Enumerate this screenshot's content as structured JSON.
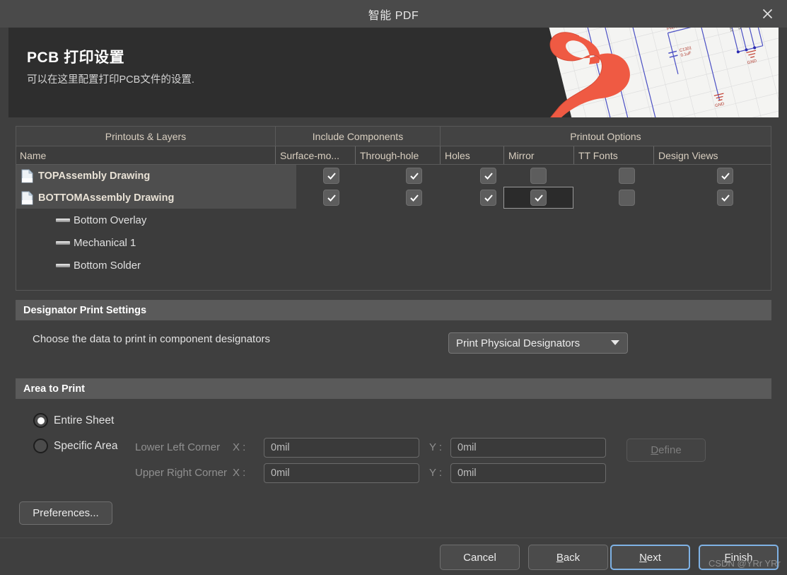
{
  "window": {
    "title": "智能 PDF",
    "close_icon": "close-icon"
  },
  "banner": {
    "title": "PCB 打印设置",
    "subtitle": "可以在这里配置打印PCB文件的设置."
  },
  "table": {
    "group_headers": [
      "Printouts & Layers",
      "Include Components",
      "Printout Options"
    ],
    "column_headers": [
      "Name",
      "Surface-mo...",
      "Through-hole",
      "Holes",
      "Mirror",
      "TT Fonts",
      "Design Views"
    ],
    "rows": [
      {
        "name": "TOPAssembly Drawing",
        "icon": "document-icon",
        "selected": true,
        "surface_mount": true,
        "through_hole": true,
        "holes": true,
        "mirror": false,
        "tt_fonts": false,
        "design_views": true,
        "focused_cell": ""
      },
      {
        "name": "BOTTOMAssembly Drawing",
        "icon": "document-icon",
        "selected": true,
        "surface_mount": true,
        "through_hole": true,
        "holes": true,
        "mirror": true,
        "tt_fonts": false,
        "design_views": true,
        "focused_cell": "mirror"
      }
    ],
    "layers": [
      {
        "name": "Bottom Overlay",
        "icon": "layer-line-icon"
      },
      {
        "name": "Mechanical 1",
        "icon": "layer-line-icon"
      },
      {
        "name": "Bottom Solder",
        "icon": "layer-line-icon"
      }
    ]
  },
  "designator_section": {
    "heading": "Designator Print Settings",
    "label": "Choose the data to print in component designators",
    "dropdown_value": "Print Physical Designators",
    "dropdown_icon": "chevron-down-icon"
  },
  "area_section": {
    "heading": "Area to Print",
    "options": [
      {
        "label": "Entire Sheet",
        "selected": true
      },
      {
        "label": "Specific Area",
        "selected": false
      }
    ],
    "lower_left_label": "Lower Left Corner",
    "upper_right_label": "Upper Right Corner",
    "x_label": "X :",
    "y_label": "Y :",
    "lower_left_x": "0mil",
    "lower_left_y": "0mil",
    "upper_right_x": "0mil",
    "upper_right_y": "0mil",
    "define_button": "Define",
    "define_accel": "D",
    "define_rest": "efine"
  },
  "preferences_button": "Preferences...",
  "footer": {
    "cancel": "Cancel",
    "back_accel": "B",
    "back_rest": "ack",
    "next_accel": "N",
    "next_rest": "ext",
    "finish_accel": "F",
    "finish_rest": "inish"
  },
  "watermark": "CSDN @YRr YRr",
  "colors": {
    "dialog_bg": "#3f3f3f",
    "titlebar_bg": "#4a4a4a",
    "banner_bg": "#2e2e2e",
    "section_header_bg": "#5a5a5a",
    "accent_blue": "#7fb2e5",
    "header_text": "#d9cfc0",
    "acrobat_red": "#ef5a43"
  }
}
